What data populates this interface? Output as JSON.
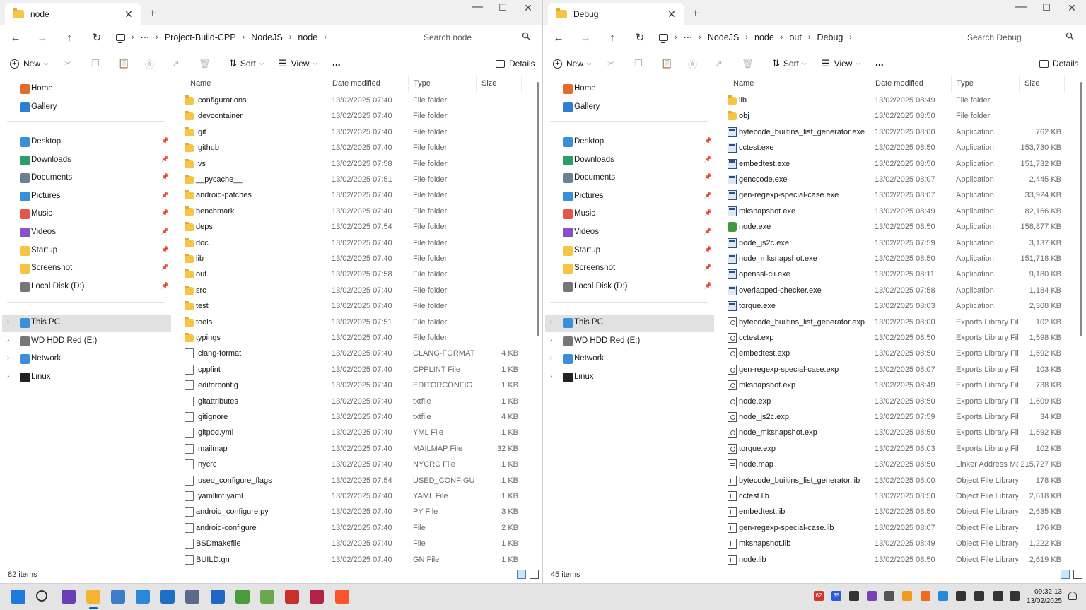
{
  "windows": [
    {
      "id": "w0",
      "tab_title": "node",
      "breadcrumb": [
        "Project-Build-CPP",
        "NodeJS",
        "node"
      ],
      "search_placeholder": "Search node",
      "status": "82 items",
      "columns": {
        "name": "Name",
        "date": "Date modified",
        "type": "Type",
        "size": "Size"
      },
      "files": [
        {
          "name": ".configurations",
          "date": "13/02/2025 07:40",
          "type": "File folder",
          "size": "",
          "icon": "folder-icon"
        },
        {
          "name": ".devcontainer",
          "date": "13/02/2025 07:40",
          "type": "File folder",
          "size": "",
          "icon": "folder-icon"
        },
        {
          "name": ".git",
          "date": "13/02/2025 07:40",
          "type": "File folder",
          "size": "",
          "icon": "folder-icon"
        },
        {
          "name": ".github",
          "date": "13/02/2025 07:40",
          "type": "File folder",
          "size": "",
          "icon": "folder-icon"
        },
        {
          "name": ".vs",
          "date": "13/02/2025 07:58",
          "type": "File folder",
          "size": "",
          "icon": "folder-icon"
        },
        {
          "name": "__pycache__",
          "date": "13/02/2025 07:51",
          "type": "File folder",
          "size": "",
          "icon": "folder-icon"
        },
        {
          "name": "android-patches",
          "date": "13/02/2025 07:40",
          "type": "File folder",
          "size": "",
          "icon": "folder-icon"
        },
        {
          "name": "benchmark",
          "date": "13/02/2025 07:40",
          "type": "File folder",
          "size": "",
          "icon": "folder-icon"
        },
        {
          "name": "deps",
          "date": "13/02/2025 07:54",
          "type": "File folder",
          "size": "",
          "icon": "folder-icon"
        },
        {
          "name": "doc",
          "date": "13/02/2025 07:40",
          "type": "File folder",
          "size": "",
          "icon": "folder-icon"
        },
        {
          "name": "lib",
          "date": "13/02/2025 07:40",
          "type": "File folder",
          "size": "",
          "icon": "folder-icon"
        },
        {
          "name": "out",
          "date": "13/02/2025 07:58",
          "type": "File folder",
          "size": "",
          "icon": "folder-icon"
        },
        {
          "name": "src",
          "date": "13/02/2025 07:40",
          "type": "File folder",
          "size": "",
          "icon": "folder-icon"
        },
        {
          "name": "test",
          "date": "13/02/2025 07:40",
          "type": "File folder",
          "size": "",
          "icon": "folder-icon"
        },
        {
          "name": "tools",
          "date": "13/02/2025 07:51",
          "type": "File folder",
          "size": "",
          "icon": "folder-icon"
        },
        {
          "name": "typings",
          "date": "13/02/2025 07:40",
          "type": "File folder",
          "size": "",
          "icon": "folder-icon"
        },
        {
          "name": ".clang-format",
          "date": "13/02/2025 07:40",
          "type": "CLANG-FORMAT ...",
          "size": "4 KB",
          "icon": "file-icon"
        },
        {
          "name": ".cpplint",
          "date": "13/02/2025 07:40",
          "type": "CPPLINT File",
          "size": "1 KB",
          "icon": "file-icon"
        },
        {
          "name": ".editorconfig",
          "date": "13/02/2025 07:40",
          "type": "EDITORCONFIG File",
          "size": "1 KB",
          "icon": "file-icon"
        },
        {
          "name": ".gitattributes",
          "date": "13/02/2025 07:40",
          "type": "txtfile",
          "size": "1 KB",
          "icon": "file-icon"
        },
        {
          "name": ".gitignore",
          "date": "13/02/2025 07:40",
          "type": "txtfile",
          "size": "4 KB",
          "icon": "file-icon"
        },
        {
          "name": ".gitpod.yml",
          "date": "13/02/2025 07:40",
          "type": "YML File",
          "size": "1 KB",
          "icon": "file-icon"
        },
        {
          "name": ".mailmap",
          "date": "13/02/2025 07:40",
          "type": "MAILMAP File",
          "size": "32 KB",
          "icon": "file-icon"
        },
        {
          "name": ".nycrc",
          "date": "13/02/2025 07:40",
          "type": "NYCRC File",
          "size": "1 KB",
          "icon": "file-icon"
        },
        {
          "name": ".used_configure_flags",
          "date": "13/02/2025 07:54",
          "type": "USED_CONFIGURE...",
          "size": "1 KB",
          "icon": "file-icon"
        },
        {
          "name": ".yamllint.yaml",
          "date": "13/02/2025 07:40",
          "type": "YAML File",
          "size": "1 KB",
          "icon": "file-icon"
        },
        {
          "name": "android_configure.py",
          "date": "13/02/2025 07:40",
          "type": "PY File",
          "size": "3 KB",
          "icon": "file-icon"
        },
        {
          "name": "android-configure",
          "date": "13/02/2025 07:40",
          "type": "File",
          "size": "2 KB",
          "icon": "file-icon"
        },
        {
          "name": "BSDmakefile",
          "date": "13/02/2025 07:40",
          "type": "File",
          "size": "1 KB",
          "icon": "file-icon"
        },
        {
          "name": "BUILD.gn",
          "date": "13/02/2025 07:40",
          "type": "GN File",
          "size": "1 KB",
          "icon": "file-icon"
        }
      ]
    },
    {
      "id": "w1",
      "tab_title": "Debug",
      "breadcrumb": [
        "NodeJS",
        "node",
        "out",
        "Debug"
      ],
      "search_placeholder": "Search Debug",
      "status": "45 items",
      "columns": {
        "name": "Name",
        "date": "Date modified",
        "type": "Type",
        "size": "Size"
      },
      "files": [
        {
          "name": "lib",
          "date": "13/02/2025 08:49",
          "type": "File folder",
          "size": "",
          "icon": "folder-icon"
        },
        {
          "name": "obj",
          "date": "13/02/2025 08:50",
          "type": "File folder",
          "size": "",
          "icon": "folder-icon"
        },
        {
          "name": "bytecode_builtins_list_generator.exe",
          "date": "13/02/2025 08:00",
          "type": "Application",
          "size": "762 KB",
          "icon": "exe-icon"
        },
        {
          "name": "cctest.exe",
          "date": "13/02/2025 08:50",
          "type": "Application",
          "size": "153,730 KB",
          "icon": "exe-icon"
        },
        {
          "name": "embedtest.exe",
          "date": "13/02/2025 08:50",
          "type": "Application",
          "size": "151,732 KB",
          "icon": "exe-icon"
        },
        {
          "name": "genccode.exe",
          "date": "13/02/2025 08:07",
          "type": "Application",
          "size": "2,445 KB",
          "icon": "exe-icon"
        },
        {
          "name": "gen-regexp-special-case.exe",
          "date": "13/02/2025 08:07",
          "type": "Application",
          "size": "33,924 KB",
          "icon": "exe-icon"
        },
        {
          "name": "mksnapshot.exe",
          "date": "13/02/2025 08:49",
          "type": "Application",
          "size": "82,166 KB",
          "icon": "exe-icon"
        },
        {
          "name": "node.exe",
          "date": "13/02/2025 08:50",
          "type": "Application",
          "size": "158,877 KB",
          "icon": "nodejs-icon"
        },
        {
          "name": "node_js2c.exe",
          "date": "13/02/2025 07:59",
          "type": "Application",
          "size": "3,137 KB",
          "icon": "exe-icon"
        },
        {
          "name": "node_mksnapshot.exe",
          "date": "13/02/2025 08:50",
          "type": "Application",
          "size": "151,718 KB",
          "icon": "exe-icon"
        },
        {
          "name": "openssl-cli.exe",
          "date": "13/02/2025 08:11",
          "type": "Application",
          "size": "9,180 KB",
          "icon": "exe-icon"
        },
        {
          "name": "overlapped-checker.exe",
          "date": "13/02/2025 07:58",
          "type": "Application",
          "size": "1,184 KB",
          "icon": "exe-icon"
        },
        {
          "name": "torque.exe",
          "date": "13/02/2025 08:03",
          "type": "Application",
          "size": "2,308 KB",
          "icon": "exe-icon"
        },
        {
          "name": "bytecode_builtins_list_generator.exp",
          "date": "13/02/2025 08:00",
          "type": "Exports Library File",
          "size": "102 KB",
          "icon": "exp-icon"
        },
        {
          "name": "cctest.exp",
          "date": "13/02/2025 08:50",
          "type": "Exports Library File",
          "size": "1,598 KB",
          "icon": "exp-icon"
        },
        {
          "name": "embedtest.exp",
          "date": "13/02/2025 08:50",
          "type": "Exports Library File",
          "size": "1,592 KB",
          "icon": "exp-icon"
        },
        {
          "name": "gen-regexp-special-case.exp",
          "date": "13/02/2025 08:07",
          "type": "Exports Library File",
          "size": "103 KB",
          "icon": "exp-icon"
        },
        {
          "name": "mksnapshot.exp",
          "date": "13/02/2025 08:49",
          "type": "Exports Library File",
          "size": "738 KB",
          "icon": "exp-icon"
        },
        {
          "name": "node.exp",
          "date": "13/02/2025 08:50",
          "type": "Exports Library File",
          "size": "1,609 KB",
          "icon": "exp-icon"
        },
        {
          "name": "node_js2c.exp",
          "date": "13/02/2025 07:59",
          "type": "Exports Library File",
          "size": "34 KB",
          "icon": "exp-icon"
        },
        {
          "name": "node_mksnapshot.exp",
          "date": "13/02/2025 08:50",
          "type": "Exports Library File",
          "size": "1,592 KB",
          "icon": "exp-icon"
        },
        {
          "name": "torque.exp",
          "date": "13/02/2025 08:03",
          "type": "Exports Library File",
          "size": "102 KB",
          "icon": "exp-icon"
        },
        {
          "name": "node.map",
          "date": "13/02/2025 08:50",
          "type": "Linker Address Map",
          "size": "215,727 KB",
          "icon": "map-icon"
        },
        {
          "name": "bytecode_builtins_list_generator.lib",
          "date": "13/02/2025 08:00",
          "type": "Object File Library",
          "size": "178 KB",
          "icon": "lib-icon"
        },
        {
          "name": "cctest.lib",
          "date": "13/02/2025 08:50",
          "type": "Object File Library",
          "size": "2,618 KB",
          "icon": "lib-icon"
        },
        {
          "name": "embedtest.lib",
          "date": "13/02/2025 08:50",
          "type": "Object File Library",
          "size": "2,635 KB",
          "icon": "lib-icon"
        },
        {
          "name": "gen-regexp-special-case.lib",
          "date": "13/02/2025 08:07",
          "type": "Object File Library",
          "size": "176 KB",
          "icon": "lib-icon"
        },
        {
          "name": "mksnapshot.lib",
          "date": "13/02/2025 08:49",
          "type": "Object File Library",
          "size": "1,222 KB",
          "icon": "lib-icon"
        },
        {
          "name": "node.lib",
          "date": "13/02/2025 08:50",
          "type": "Object File Library",
          "size": "2,619 KB",
          "icon": "lib-icon"
        }
      ]
    }
  ],
  "commandbar": {
    "new": "New",
    "sort": "Sort",
    "view": "View",
    "more": "...",
    "details": "Details"
  },
  "navpane": {
    "top": [
      {
        "label": "Home",
        "icon": "home-icon",
        "color": "#e06c2e"
      },
      {
        "label": "Gallery",
        "icon": "gallery-icon",
        "color": "#2f7fd1"
      }
    ],
    "quick": [
      {
        "label": "Desktop",
        "icon": "desktop-icon",
        "color": "#3a8fd9"
      },
      {
        "label": "Downloads",
        "icon": "downloads-icon",
        "color": "#2e9d6a"
      },
      {
        "label": "Documents",
        "icon": "documents-icon",
        "color": "#6b7f95"
      },
      {
        "label": "Pictures",
        "icon": "pictures-icon",
        "color": "#3a8fd9"
      },
      {
        "label": "Music",
        "icon": "music-icon",
        "color": "#e1574b"
      },
      {
        "label": "Videos",
        "icon": "videos-icon",
        "color": "#8652c9"
      },
      {
        "label": "Startup",
        "icon": "folder-icon",
        "color": "#f7c546"
      },
      {
        "label": "Screenshot",
        "icon": "folder-icon",
        "color": "#f7c546"
      },
      {
        "label": "Local Disk (D:)",
        "icon": "drive-icon",
        "color": "#777777"
      }
    ],
    "tree": [
      {
        "label": "This PC",
        "icon": "pc-icon",
        "color": "#3a8fd9",
        "selected": true
      },
      {
        "label": "WD HDD Red (E:)",
        "icon": "drive-icon",
        "color": "#777777",
        "selected": false
      },
      {
        "label": "Network",
        "icon": "network-icon",
        "color": "#3a8fd9",
        "selected": false
      },
      {
        "label": "Linux",
        "icon": "linux-icon",
        "color": "#222222",
        "selected": false
      }
    ]
  },
  "taskbar": {
    "apps": [
      {
        "name": "start-icon",
        "color": "#1f7ae0"
      },
      {
        "name": "search-icon",
        "color": "#333333"
      },
      {
        "name": "media-player-icon",
        "color": "#6a3fb5"
      },
      {
        "name": "file-explorer-icon",
        "color": "#f2b632"
      },
      {
        "name": "remote-desktop-icon",
        "color": "#3d7cc9"
      },
      {
        "name": "photos-icon",
        "color": "#2b87d8"
      },
      {
        "name": "calculator-icon",
        "color": "#1c6fc4"
      },
      {
        "name": "network-tool-icon",
        "color": "#5a6c8a"
      },
      {
        "name": "regedit-icon",
        "color": "#2066c7"
      },
      {
        "name": "unity-icon",
        "color": "#4a9c3a"
      },
      {
        "name": "notepad-plus-icon",
        "color": "#6aa84f"
      },
      {
        "name": "filezilla-icon",
        "color": "#c9302c"
      },
      {
        "name": "terminal-app-icon",
        "color": "#b22244"
      },
      {
        "name": "brave-icon",
        "color": "#fb542b"
      }
    ],
    "tray_badges": [
      "62",
      "35"
    ],
    "time": "09:32:13",
    "date": "13/02/2025"
  }
}
